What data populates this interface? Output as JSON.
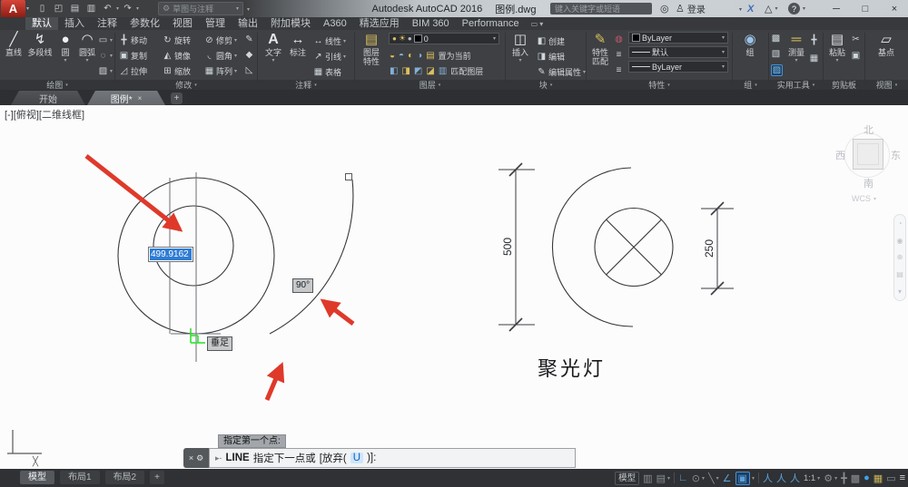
{
  "glyphs": {
    "caret": "▾",
    "cross": "╳"
  },
  "titlebar": {
    "logo_letter": "A",
    "qat": {
      "new": "▯",
      "open": "◰",
      "save": "▤",
      "print": "▥",
      "undo": "↶",
      "redo": "↷",
      "workspace_gear": "⚙",
      "workspace": "草图与注释"
    },
    "app_title": "Autodesk AutoCAD 2016",
    "doc_title": "图例.dwg",
    "search_placeholder": "键入关键字或短语",
    "binoculars_icon": "◎",
    "signin": {
      "user_icon": "♙",
      "label": "登录"
    },
    "a360_icon": "X",
    "tria_icon": "△",
    "help_icon": "?",
    "win": {
      "min": "─",
      "max": "□",
      "close": "×"
    }
  },
  "ribbon": {
    "tabs": [
      "默认",
      "插入",
      "注释",
      "参数化",
      "视图",
      "管理",
      "输出",
      "附加模块",
      "A360",
      "精选应用",
      "BIM 360",
      "Performance"
    ],
    "panel_toggle_icon": "▭",
    "draw": {
      "label": "绘图",
      "line": {
        "icon": "╱",
        "label": "直线"
      },
      "pline": {
        "icon": "↯",
        "label": "多段线"
      },
      "circle": {
        "icon": "●",
        "label": "圆"
      },
      "arc": {
        "icon": "◠",
        "label": "圆弧"
      },
      "small": [
        "▭",
        "◌",
        "▨"
      ]
    },
    "modify": {
      "label": "修改",
      "cells": [
        {
          "icon": "╋",
          "label": "移动"
        },
        {
          "icon": "↻",
          "label": "旋转"
        },
        {
          "icon": "⊘",
          "label": "修剪"
        },
        {
          "icon": "▣",
          "label": "复制"
        },
        {
          "icon": "◭",
          "label": "镜像"
        },
        {
          "icon": "◟",
          "label": "圆角"
        },
        {
          "icon": "◿",
          "label": "拉伸"
        },
        {
          "icon": "⊞",
          "label": "缩放"
        },
        {
          "icon": "▦",
          "label": "阵列"
        }
      ],
      "col": [
        "✎",
        "◆",
        "◺"
      ]
    },
    "annotate": {
      "label": "注释",
      "text": {
        "icon": "A",
        "label": "文字"
      },
      "dim": {
        "icon": "↔",
        "label": "标注"
      },
      "small": [
        {
          "icon": "↔",
          "label": "线性"
        },
        {
          "icon": "↗",
          "label": "引线"
        },
        {
          "icon": "▦",
          "label": "表格"
        }
      ]
    },
    "layers": {
      "label": "图层",
      "properties_btn": {
        "icon": "▤",
        "label1": "图层",
        "label2": "特性"
      },
      "combo": {
        "bulb": "●",
        "sun": "☀",
        "lock": "●",
        "value": "0"
      },
      "row_icons1": [
        "◒",
        "◓",
        "◐",
        "◑",
        "▤"
      ],
      "row1_label": "置为当前",
      "row_icons2": [
        "◧",
        "◨",
        "◩",
        "◪",
        "▥"
      ],
      "row2_label": "匹配图层"
    },
    "block": {
      "label": "块",
      "insert": {
        "icon": "◫",
        "label": "插入"
      },
      "items": [
        {
          "icon": "◧",
          "label": "创建"
        },
        {
          "icon": "◨",
          "label": "编辑"
        },
        {
          "icon": "✎",
          "label": "编辑属性"
        }
      ]
    },
    "props": {
      "label": "特性",
      "match": {
        "icon": "✎",
        "label1": "特性",
        "label2": "匹配"
      },
      "col_icons": [
        "◍",
        "≡",
        "≡"
      ],
      "color_value": "ByLayer",
      "lineweight_value": "默认",
      "linetype_value": "ByLayer"
    },
    "group": {
      "label": "组",
      "btn": {
        "icon": "◉",
        "label": "组"
      }
    },
    "utils": {
      "label": "实用工具",
      "col": [
        "▩",
        "▧",
        "▨"
      ],
      "measure": {
        "icon": "═",
        "label": "测量"
      },
      "right": [
        "╋",
        "▦"
      ]
    },
    "clipboard": {
      "label": "剪贴板",
      "paste": {
        "icon": "▤",
        "label": "粘贴"
      },
      "col": [
        "✂",
        "▣"
      ]
    },
    "view": {
      "label": "视图",
      "base": {
        "icon": "▱",
        "label": "基点"
      }
    }
  },
  "file_tabs": {
    "start": "开始",
    "doc": "图例*",
    "close_icon": "×",
    "add_icon": "+"
  },
  "canvas": {
    "viewport_label": "[-][俯视][二维线框]",
    "dim_input": "499.9162",
    "angle_tip": "90°",
    "osnap_tip": "垂足",
    "prompt_tip": "指定第一个点:",
    "figure_label": "聚光灯",
    "dim_left": "500",
    "dim_right": "250"
  },
  "viewcube": {
    "n": "北",
    "s": "南",
    "e": "东",
    "w": "西",
    "wcs": "WCS"
  },
  "navbar_icons": [
    "◔",
    "◉",
    "⊕",
    "▤",
    "▾"
  ],
  "command": {
    "close": "×",
    "tool": "⚙",
    "prompt_icon": "▸-",
    "cmd": "LINE",
    "prompt": "指定下一点或",
    "opt_pre": "[放弃(",
    "opt_key": "U",
    "opt_post": ")]:"
  },
  "statusbar": {
    "model_tab": "模型",
    "layout1": "布局1",
    "layout2": "布局2",
    "add": "+",
    "model_chip": "模型",
    "scale": "1:1",
    "icons": {
      "grid": "▥",
      "snap": "▤",
      "ortho": "∟",
      "polar": "⊙",
      "iso": "╲",
      "otrack": "∠",
      "osnap": "▣",
      "ann1": "人",
      "ann2": "人",
      "ann3": "人",
      "gear": "⚙",
      "plus": "╋",
      "qp": "▩",
      "isolate": "●",
      "hw": "▦",
      "clean": "▭",
      "menu": "≡"
    }
  }
}
